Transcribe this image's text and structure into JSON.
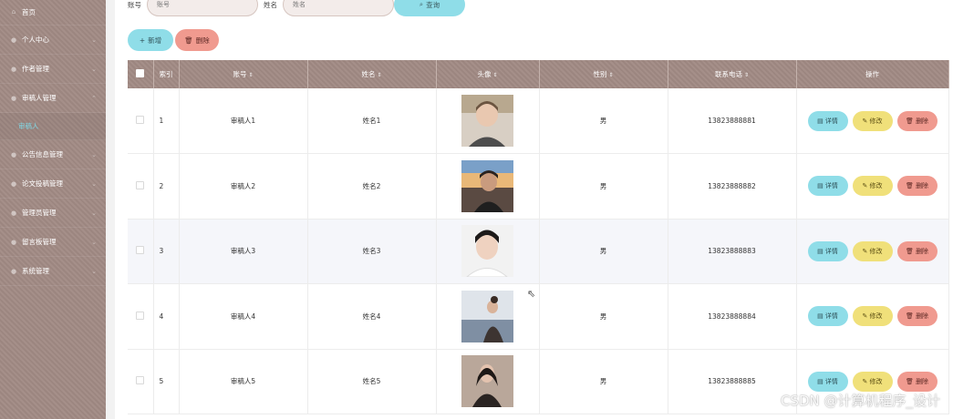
{
  "sidebar": {
    "items": [
      {
        "label": "首页",
        "icon": "home-icon"
      },
      {
        "label": "个人中心",
        "icon": "user-icon"
      },
      {
        "label": "作者管理",
        "icon": "user-icon"
      },
      {
        "label": "审稿人管理",
        "icon": "user-icon"
      },
      {
        "label": "审稿人",
        "icon": "",
        "sub": true
      },
      {
        "label": "公告信息管理",
        "icon": "bell-icon"
      },
      {
        "label": "论文投稿管理",
        "icon": "doc-icon"
      },
      {
        "label": "管理员管理",
        "icon": "user-icon"
      },
      {
        "label": "留言板管理",
        "icon": "chat-icon"
      },
      {
        "label": "系统管理",
        "icon": "gear-icon"
      }
    ]
  },
  "search": {
    "account_label": "账号",
    "account_placeholder": "账号",
    "name_label": "姓名",
    "name_placeholder": "姓名",
    "button_label": "查询"
  },
  "toolbar": {
    "add_label": "新增",
    "delete_label": "删除"
  },
  "table": {
    "columns": [
      "索引",
      "账号",
      "姓名",
      "头像",
      "性别",
      "联系电话",
      "操作"
    ],
    "rows": [
      {
        "index": "1",
        "account": "审稿人1",
        "name": "姓名1",
        "gender": "男",
        "phone": "13823888881"
      },
      {
        "index": "2",
        "account": "审稿人2",
        "name": "姓名2",
        "gender": "男",
        "phone": "13823888882"
      },
      {
        "index": "3",
        "account": "审稿人3",
        "name": "姓名3",
        "gender": "男",
        "phone": "13823888883"
      },
      {
        "index": "4",
        "account": "审稿人4",
        "name": "姓名4",
        "gender": "男",
        "phone": "13823888884"
      },
      {
        "index": "5",
        "account": "审稿人5",
        "name": "姓名5",
        "gender": "男",
        "phone": "13823888885"
      }
    ],
    "op_detail": "详情",
    "op_edit": "修改",
    "op_delete": "删除"
  },
  "watermark": "CSDN @计算机程序_设计",
  "colors": {
    "sidebar_bg": "#a08a84",
    "accent_cyan": "#8fdde8",
    "accent_yellow": "#f0e07a",
    "accent_red": "#f09a8f",
    "active_sub": "#7fd3e0"
  }
}
